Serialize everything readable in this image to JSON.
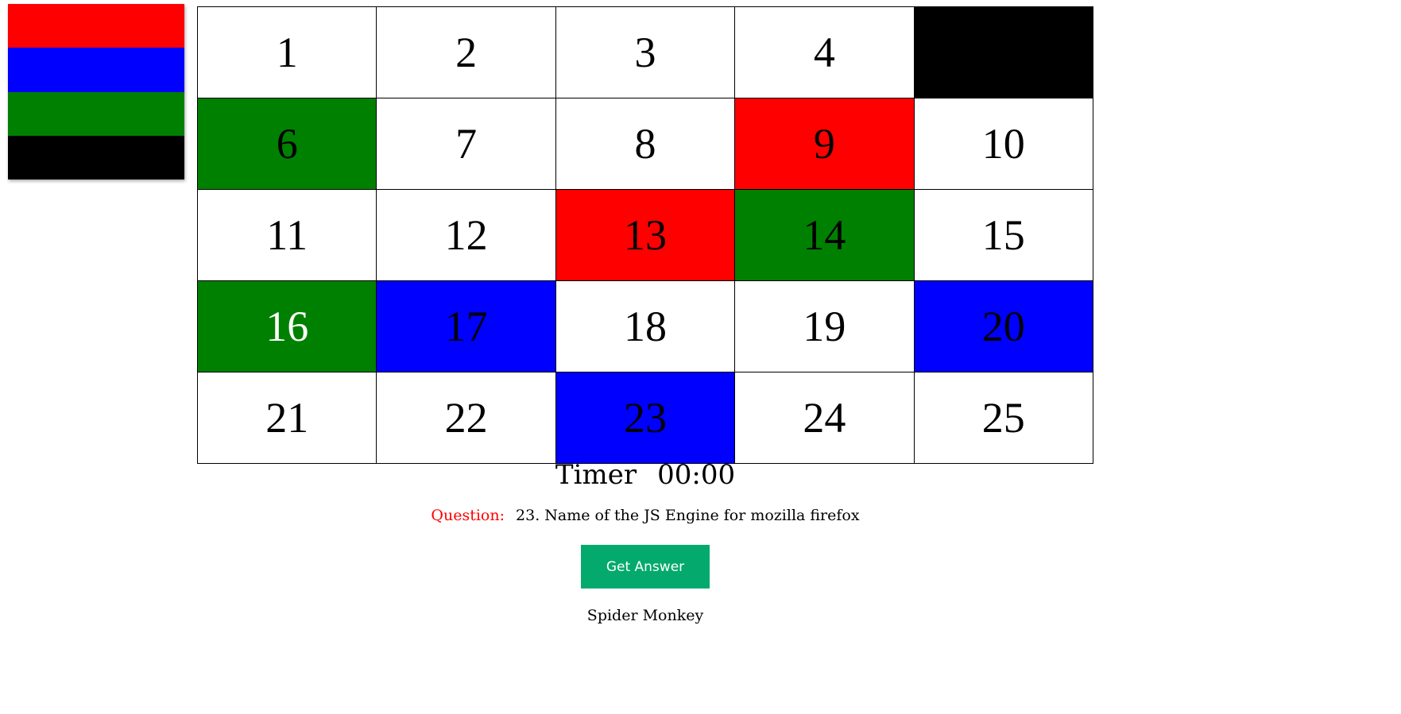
{
  "palette": {
    "colors": [
      {
        "name": "red",
        "hex": "#ff0000"
      },
      {
        "name": "blue",
        "hex": "#0000ff"
      },
      {
        "name": "green",
        "hex": "#008000"
      },
      {
        "name": "black",
        "hex": "#000000"
      }
    ]
  },
  "board": {
    "rows": [
      [
        {
          "label": "1",
          "bg": "#ffffff",
          "fg": "#000000"
        },
        {
          "label": "2",
          "bg": "#ffffff",
          "fg": "#000000"
        },
        {
          "label": "3",
          "bg": "#ffffff",
          "fg": "#000000"
        },
        {
          "label": "4",
          "bg": "#ffffff",
          "fg": "#000000"
        },
        {
          "label": "",
          "bg": "#000000",
          "fg": "#000000"
        }
      ],
      [
        {
          "label": "6",
          "bg": "#008000",
          "fg": "#000000"
        },
        {
          "label": "7",
          "bg": "#ffffff",
          "fg": "#000000"
        },
        {
          "label": "8",
          "bg": "#ffffff",
          "fg": "#000000"
        },
        {
          "label": "9",
          "bg": "#ff0000",
          "fg": "#000000"
        },
        {
          "label": "10",
          "bg": "#ffffff",
          "fg": "#000000"
        }
      ],
      [
        {
          "label": "11",
          "bg": "#ffffff",
          "fg": "#000000"
        },
        {
          "label": "12",
          "bg": "#ffffff",
          "fg": "#000000"
        },
        {
          "label": "13",
          "bg": "#ff0000",
          "fg": "#000000"
        },
        {
          "label": "14",
          "bg": "#008000",
          "fg": "#000000"
        },
        {
          "label": "15",
          "bg": "#ffffff",
          "fg": "#000000"
        }
      ],
      [
        {
          "label": "16",
          "bg": "#008000",
          "fg": "#ffffff"
        },
        {
          "label": "17",
          "bg": "#0000ff",
          "fg": "#000000"
        },
        {
          "label": "18",
          "bg": "#ffffff",
          "fg": "#000000"
        },
        {
          "label": "19",
          "bg": "#ffffff",
          "fg": "#000000"
        },
        {
          "label": "20",
          "bg": "#0000ff",
          "fg": "#000000"
        }
      ],
      [
        {
          "label": "21",
          "bg": "#ffffff",
          "fg": "#000000"
        },
        {
          "label": "22",
          "bg": "#ffffff",
          "fg": "#000000"
        },
        {
          "label": "23",
          "bg": "#0000ff",
          "fg": "#000000"
        },
        {
          "label": "24",
          "bg": "#ffffff",
          "fg": "#000000"
        },
        {
          "label": "25",
          "bg": "#ffffff",
          "fg": "#000000"
        }
      ]
    ]
  },
  "timer": {
    "label": "Timer",
    "value": "00:00"
  },
  "question": {
    "label": "Question:",
    "text": "23. Name of the JS Engine for mozilla firefox"
  },
  "answer_button": {
    "label": "Get Answer",
    "color": "#04aa6d"
  },
  "answer": {
    "text": "Spider Monkey"
  }
}
